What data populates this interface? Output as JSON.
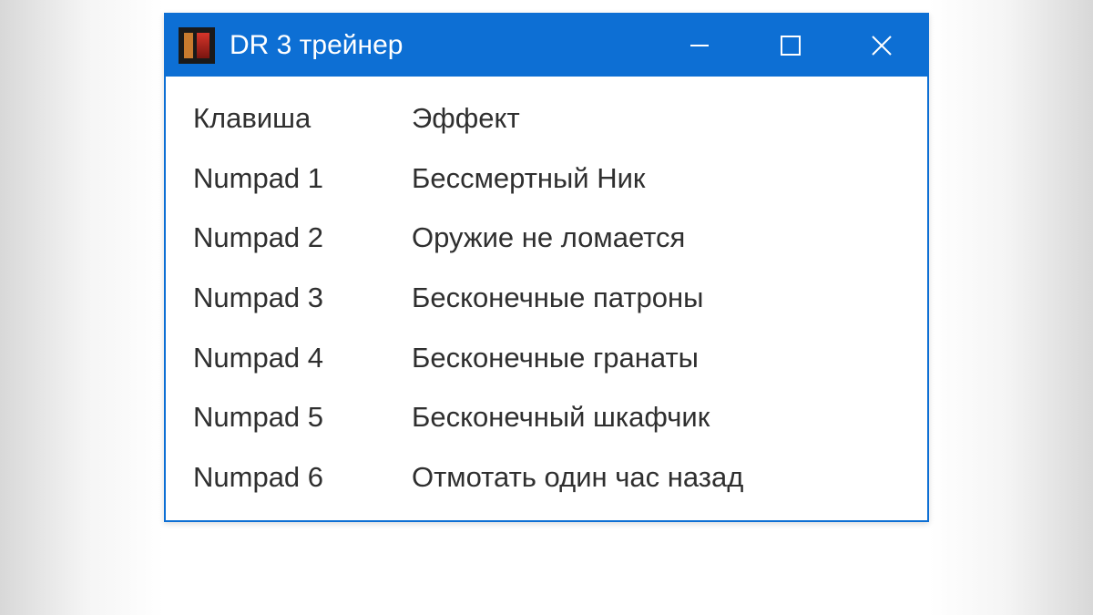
{
  "window": {
    "title": "DR 3 трейнер"
  },
  "headers": {
    "key": "Клавиша",
    "effect": "Эффект"
  },
  "rows": [
    {
      "key": "Numpad 1",
      "effect": "Бессмертный Ник"
    },
    {
      "key": "Numpad 2",
      "effect": "Оружие не ломается"
    },
    {
      "key": "Numpad 3",
      "effect": "Бесконечные патроны"
    },
    {
      "key": "Numpad 4",
      "effect": "Бесконечные гранаты"
    },
    {
      "key": "Numpad 5",
      "effect": "Бесконечный шкафчик"
    },
    {
      "key": "Numpad 6",
      "effect": "Отмотать один час назад"
    }
  ]
}
